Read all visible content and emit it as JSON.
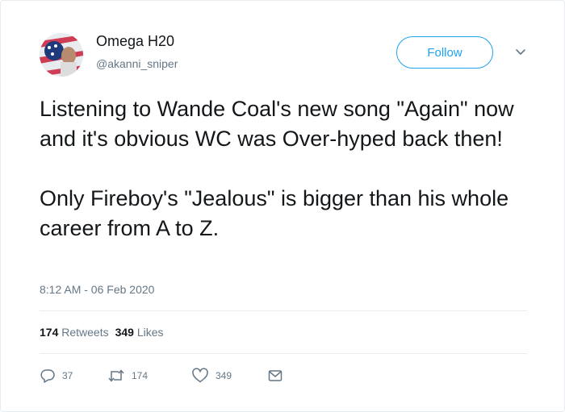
{
  "author": {
    "name": "Omega H20",
    "handle": "@akanni_sniper"
  },
  "follow_label": "Follow",
  "tweet": {
    "paragraphs": [
      "Listening to Wande Coal's new song \"Again\" now and it's obvious WC was Over-hyped back then!",
      "Only Fireboy's \"Jealous\" is bigger than his whole career from A to Z."
    ],
    "timestamp": "8:12 AM - 06 Feb 2020"
  },
  "stats": {
    "retweets_count": "174",
    "retweets_label": "Retweets",
    "likes_count": "349",
    "likes_label": "Likes"
  },
  "actions": {
    "reply_count": "37",
    "retweet_count": "174",
    "like_count": "349"
  },
  "colors": {
    "accent": "#1da1f2",
    "secondary_text": "#657786",
    "divider": "#e6ecf0"
  },
  "icons": [
    "reply-icon",
    "retweet-icon",
    "heart-icon",
    "message-icon",
    "chevron-down-icon"
  ]
}
